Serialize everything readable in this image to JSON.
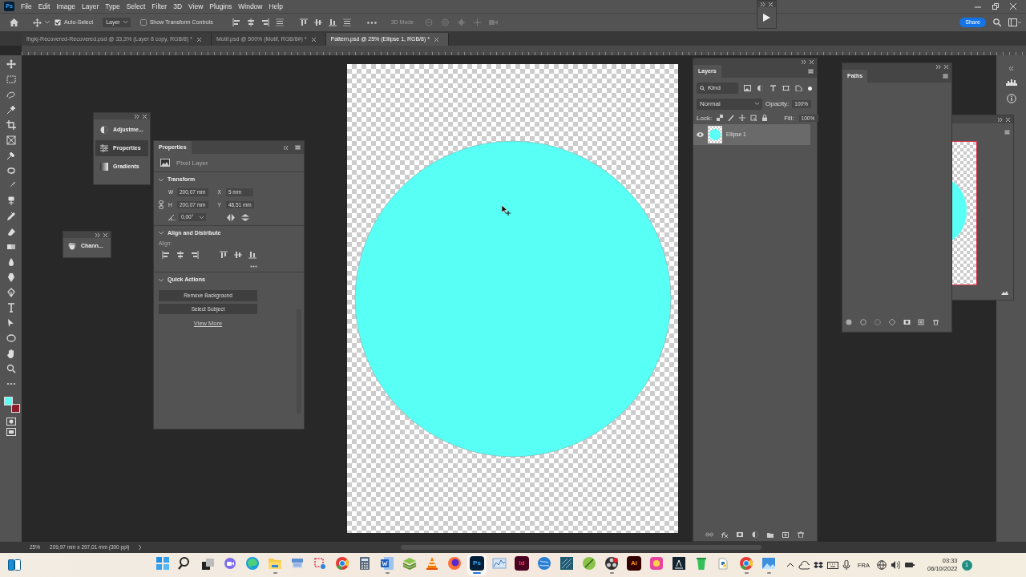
{
  "menu_bar": {
    "logo": "Ps",
    "items": [
      "File",
      "Edit",
      "Image",
      "Layer",
      "Type",
      "Select",
      "Filter",
      "3D",
      "View",
      "Plugins",
      "Window",
      "Help"
    ]
  },
  "options_bar": {
    "auto_select": {
      "label": "Auto-Select",
      "checked": true
    },
    "target": "Layer",
    "show_transform": {
      "label": "Show Transform Controls",
      "checked": false
    },
    "mode_3d": {
      "label": "3D Mode",
      "disabled": true
    },
    "share": "Share"
  },
  "document_tabs": [
    {
      "label": "fhgkj-Recovered-Recovered.psd @ 33,3% (Layer 8 copy, RGB/8) *",
      "selected": false
    },
    {
      "label": "Motif.psd @ 500% (Motif, RGB/8#) *",
      "selected": false
    },
    {
      "label": "Pattern.psd @ 25% (Ellipse 1, RGB/8) *",
      "selected": true
    }
  ],
  "color_swatches": [
    {
      "kind": "foreground",
      "color": "#5cfff4"
    },
    {
      "kind": "background",
      "color": "#8e1b2b"
    }
  ],
  "dock_panel": {
    "items": [
      {
        "kind": "adjustments",
        "label": "Adjustme...",
        "selected": false
      },
      {
        "kind": "properties",
        "label": "Properties",
        "selected": true
      },
      {
        "kind": "gradients",
        "label": "Gradients",
        "selected": false
      }
    ]
  },
  "channels_panel": {
    "label": "Chann..."
  },
  "properties_panel": {
    "title": "Properties",
    "layer_type": "Pixel Layer",
    "transform": {
      "title": "Transform",
      "expanded": true,
      "w_label": "W",
      "w": "200,07 mm",
      "x_label": "X",
      "x": "5 mm",
      "h_label": "H",
      "h": "200,07 mm",
      "y_label": "Y",
      "y": "48,51 mm",
      "angle": "0,00°"
    },
    "align": {
      "title": "Align and Distribute",
      "expanded": true,
      "label": "Align:"
    },
    "quick_actions": {
      "title": "Quick Actions",
      "expanded": true,
      "buttons": [
        "Remove Background",
        "Select Subject"
      ],
      "link": "View More"
    }
  },
  "layers_panel": {
    "title": "Layers",
    "filter": "Kind",
    "blend_mode": "Normal",
    "opacity_label": "Opacity:",
    "opacity": "100%",
    "lock_label": "Lock:",
    "fill_label": "Fill:",
    "fill": "100%",
    "layers": [
      {
        "name": "Ellipse 1",
        "visible": true,
        "selected": true
      }
    ]
  },
  "paths_panel": {
    "title": "Paths"
  },
  "status_bar": {
    "zoom": "25%",
    "doc_info": "209,97 mm x 297,01 mm (300 ppi)"
  },
  "taskbar": {
    "apps": [
      {
        "kind": "start",
        "running": false,
        "selected": false
      },
      {
        "kind": "search",
        "running": false,
        "selected": false
      },
      {
        "kind": "taskview",
        "running": false,
        "selected": false
      },
      {
        "kind": "chat",
        "running": false,
        "selected": false
      },
      {
        "kind": "edge",
        "running": false,
        "selected": false
      },
      {
        "kind": "folder",
        "running": true,
        "selected": false
      },
      {
        "kind": "scanner",
        "running": false,
        "selected": false
      },
      {
        "kind": "snip",
        "running": false,
        "selected": false
      },
      {
        "kind": "chrome",
        "running": false,
        "selected": false
      },
      {
        "kind": "calculator",
        "running": false,
        "selected": false
      },
      {
        "kind": "word",
        "running": true,
        "selected": false
      },
      {
        "kind": "stack",
        "running": false,
        "selected": false
      },
      {
        "kind": "cone",
        "running": false,
        "selected": false
      },
      {
        "kind": "firefox",
        "running": false,
        "selected": false
      },
      {
        "kind": "letter",
        "label": "Ps",
        "running": true,
        "selected": true
      },
      {
        "kind": "chart",
        "running": false,
        "selected": false
      },
      {
        "kind": "letter",
        "label": "Id",
        "running": false,
        "selected": false
      },
      {
        "kind": "globe",
        "running": false,
        "selected": false
      },
      {
        "kind": "tile",
        "running": false,
        "selected": false
      },
      {
        "kind": "leaf",
        "running": false,
        "selected": false
      },
      {
        "kind": "obs",
        "running": true,
        "selected": false
      },
      {
        "kind": "letter",
        "label": "Ai",
        "running": false,
        "selected": false
      },
      {
        "kind": "ring",
        "running": false,
        "selected": false
      },
      {
        "kind": "reader",
        "running": false,
        "selected": false
      },
      {
        "kind": "bin",
        "running": false,
        "selected": false
      },
      {
        "kind": "python",
        "running": false,
        "selected": false
      },
      {
        "kind": "chrome",
        "running": true,
        "selected": false
      },
      {
        "kind": "photos",
        "running": true,
        "selected": false
      }
    ],
    "language": "FRA",
    "time": "03:33",
    "date": "06/10/2022",
    "notifications": "1"
  }
}
